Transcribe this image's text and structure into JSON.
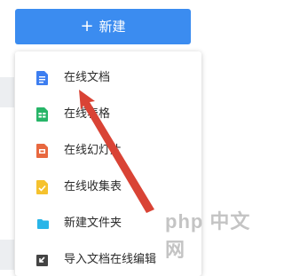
{
  "new_button": {
    "icon": "plus-icon",
    "label": "新建",
    "color": "#3b8cf0"
  },
  "menu": {
    "items": [
      {
        "label": "在线文档",
        "icon": "doc-icon",
        "color": "#3d7ef0"
      },
      {
        "label": "在线表格",
        "icon": "sheet-icon",
        "color": "#27b568"
      },
      {
        "label": "在线幻灯片",
        "icon": "slides-icon",
        "color": "#e8683f"
      },
      {
        "label": "在线收集表",
        "icon": "form-icon",
        "color": "#f5c22e"
      },
      {
        "label": "新建文件夹",
        "icon": "folder-icon",
        "color": "#29b5e8"
      },
      {
        "label": "导入文档在线编辑",
        "icon": "import-icon",
        "color": "#444444"
      }
    ]
  },
  "annotation": {
    "arrow_color": "#d94335"
  },
  "watermark": {
    "text": "php 中文网"
  }
}
